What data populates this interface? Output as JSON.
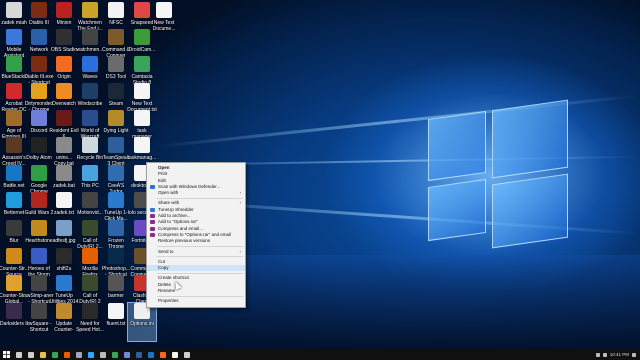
{
  "desktop": {
    "icons": [
      {
        "label": "zadek miah",
        "color": "#d7d7d7"
      },
      {
        "label": "Diablo III",
        "color": "#7a2d12"
      },
      {
        "label": "Minion",
        "color": "#b8211e"
      },
      {
        "label": "Watchmen The End i...",
        "color": "#c9a227"
      },
      {
        "label": "NFSC",
        "color": "#f2f2f2"
      },
      {
        "label": "Snapseed",
        "color": "#e04848"
      },
      {
        "label": "New Text Docume...",
        "color": "#f5f5f5"
      },
      {
        "label": "Mobile Assistant",
        "color": "#3c78d8"
      },
      {
        "label": "Network",
        "color": "#2b5fa8"
      },
      {
        "label": "OBS Studio",
        "color": "#303030"
      },
      {
        "label": "watchmen...",
        "color": "#444444"
      },
      {
        "label": "Command & Conquer Ge...",
        "color": "#7d5a2b"
      },
      {
        "label": "DroidCam...",
        "color": "#3b9b3b"
      },
      {
        "label": "BlueStacks",
        "color": "#35a04a"
      },
      {
        "label": "Diablo III.exe - Shortcut",
        "color": "#7a2d12"
      },
      {
        "label": "Origin",
        "color": "#f26b21"
      },
      {
        "label": "Waves",
        "color": "#2a6fdb"
      },
      {
        "label": "DS3 Tool",
        "color": "#6b6b6b"
      },
      {
        "label": "Camtasia Studio 8",
        "color": "#3aa55a"
      },
      {
        "label": "Acrobat Reader DC",
        "color": "#d22a2a"
      },
      {
        "label": "Dirtymonded - Chrome",
        "color": "#e3a21a"
      },
      {
        "label": "Overwatch",
        "color": "#f08a24"
      },
      {
        "label": "Windscribe",
        "color": "#1b3f66"
      },
      {
        "label": "Steam",
        "color": "#1b2838"
      },
      {
        "label": "New Text Document.txt",
        "color": "#f5f5f5"
      },
      {
        "label": "Age of Empires III",
        "color": "#a06a2c"
      },
      {
        "label": "Discord",
        "color": "#6f7fd8"
      },
      {
        "label": "Resident Evil 6",
        "color": "#6b1a1a"
      },
      {
        "label": "World of Warcraft",
        "color": "#2a4d8f"
      },
      {
        "label": "Dying Light",
        "color": "#b58a28"
      },
      {
        "label": "task manager bat.txt",
        "color": "#f5f5f5"
      },
      {
        "label": "Assassin's Creed IV...",
        "color": "#5a3b22"
      },
      {
        "label": "Dolby Atom",
        "color": "#222222"
      },
      {
        "label": "unins... Copy.bat",
        "color": "#8a8a8a"
      },
      {
        "label": "Recycle Bin",
        "color": "#cfd8dc"
      },
      {
        "label": "TeamSpeak 3 Client",
        "color": "#2d5f9a"
      },
      {
        "label": "taskmanag...",
        "color": "#f5f5f5"
      },
      {
        "label": "Battle.net",
        "color": "#1777c4"
      },
      {
        "label": "Google Chrome",
        "color": "#2f9e44"
      },
      {
        "label": "zadek.bat",
        "color": "#8a8a8a"
      },
      {
        "label": "This PC",
        "color": "#4aa3df"
      },
      {
        "label": "CeeA'S Tudor Backup Fre...",
        "color": "#2f6db0"
      },
      {
        "label": "desktop...",
        "color": "#f5f5f5"
      },
      {
        "label": "Betternet",
        "color": "#1f9bde"
      },
      {
        "label": "Guild Wars 2",
        "color": "#b3261e"
      },
      {
        "label": "zadek.txt",
        "color": "#f5f5f5"
      },
      {
        "label": "Motionvid...",
        "color": "#444444"
      },
      {
        "label": "TuneUp 1-Click Ma...",
        "color": "#2a7bd0"
      },
      {
        "label": "Iolo secure...",
        "color": "#4d4d4d"
      },
      {
        "label": "Blur",
        "color": "#3a3a3a"
      },
      {
        "label": "Hearthstone",
        "color": "#c28a1e"
      },
      {
        "label": "adfesfj.jpg",
        "color": "#7aa0c8"
      },
      {
        "label": "Call of Duty(R) 2...",
        "color": "#3a4a2a"
      },
      {
        "label": "Frozen Throne",
        "color": "#3064a8"
      },
      {
        "label": "Fortnite...",
        "color": "#6a4bc4"
      },
      {
        "label": "Counter-Str... Source",
        "color": "#d08a1a"
      },
      {
        "label": "Heroes of the Storm",
        "color": "#3b5cc4"
      },
      {
        "label": "shift2u",
        "color": "#2b2b2b"
      },
      {
        "label": "Mozilla Firefox",
        "color": "#e66000"
      },
      {
        "label": "Photoshop... - Shortcut",
        "color": "#0a2a4a"
      },
      {
        "label": "Command Conquer...",
        "color": "#6a5226"
      },
      {
        "label": "Counter-Str... Global...",
        "color": "#e0a030"
      },
      {
        "label": "swSimp-aner - Shortcut",
        "color": "#444444"
      },
      {
        "label": "TuneUp Utilities 2014",
        "color": "#2a7bd0"
      },
      {
        "label": "Call of Duty(R) 2 Multi...",
        "color": "#3a4a2a"
      },
      {
        "label": "barmer",
        "color": "#555555"
      },
      {
        "label": "Clash of Clans",
        "color": "#c7342a"
      },
      {
        "label": "Darksiders II",
        "color": "#3b2b4a"
      },
      {
        "label": "swSquare - Shortcut",
        "color": "#444444"
      },
      {
        "label": "Update Counter-Stri...",
        "color": "#c08a30"
      },
      {
        "label": "Need for Speed Hot...",
        "color": "#2a2a2a"
      },
      {
        "label": "fluent.txt",
        "color": "#f5f5f5"
      },
      {
        "label": "Options.ini",
        "color": "#f0f0f0"
      }
    ]
  },
  "context_menu": {
    "items": [
      {
        "type": "item",
        "label": "Open",
        "bold": true
      },
      {
        "type": "item",
        "label": "Print"
      },
      {
        "type": "item",
        "label": "Edit"
      },
      {
        "type": "item",
        "label": "Scan with Windows Defender...",
        "icon": "#2a6fdb"
      },
      {
        "type": "item",
        "label": "Open with",
        "submenu": true
      },
      {
        "type": "sep"
      },
      {
        "type": "item",
        "label": "Share with",
        "submenu": true
      },
      {
        "type": "item",
        "label": "TuneUp Shredder",
        "icon": "#2a7bd0"
      },
      {
        "type": "item",
        "label": "Add to archive...",
        "icon": "#8b2d8b"
      },
      {
        "type": "item",
        "label": "Add to \"Options.rar\"",
        "icon": "#8b2d8b"
      },
      {
        "type": "item",
        "label": "Compress and email...",
        "icon": "#8b2d8b"
      },
      {
        "type": "item",
        "label": "Compress to \"Options.rar\" and email",
        "icon": "#8b2d8b"
      },
      {
        "type": "item",
        "label": "Restore previous versions"
      },
      {
        "type": "sep"
      },
      {
        "type": "item",
        "label": "Send to",
        "submenu": true
      },
      {
        "type": "sep"
      },
      {
        "type": "item",
        "label": "Cut"
      },
      {
        "type": "item",
        "label": "Copy",
        "highlighted": true
      },
      {
        "type": "sep"
      },
      {
        "type": "item",
        "label": "Create shortcut"
      },
      {
        "type": "item",
        "label": "Delete"
      },
      {
        "type": "item",
        "label": "Rename"
      },
      {
        "type": "sep"
      },
      {
        "type": "item",
        "label": "Properties"
      }
    ]
  },
  "taskbar": {
    "start_icon": "windows-start-icon",
    "pinned": [
      {
        "name": "search-icon",
        "color": "#cfcfcf"
      },
      {
        "name": "task-view-icon",
        "color": "#cfcfcf"
      },
      {
        "name": "file-explorer-icon",
        "color": "#e8c14a"
      },
      {
        "name": "chrome-icon",
        "color": "#3aa55a"
      },
      {
        "name": "firefox-icon",
        "color": "#e66000"
      },
      {
        "name": "steam-icon",
        "color": "#9aa8b8"
      },
      {
        "name": "photoshop-icon",
        "color": "#31a8ff"
      },
      {
        "name": "obs-icon",
        "color": "#bbbbbb"
      },
      {
        "name": "camtasia-icon",
        "color": "#3aa55a"
      },
      {
        "name": "discord-icon",
        "color": "#7289da"
      },
      {
        "name": "teamspeak-icon",
        "color": "#2d5f9a"
      },
      {
        "name": "battlenet-icon",
        "color": "#1777c4"
      },
      {
        "name": "origin-icon",
        "color": "#f26b21"
      },
      {
        "name": "notepad-icon",
        "color": "#f5f5f5"
      },
      {
        "name": "settings-icon",
        "color": "#cfcfcf"
      }
    ],
    "clock": "10:41 PM"
  }
}
